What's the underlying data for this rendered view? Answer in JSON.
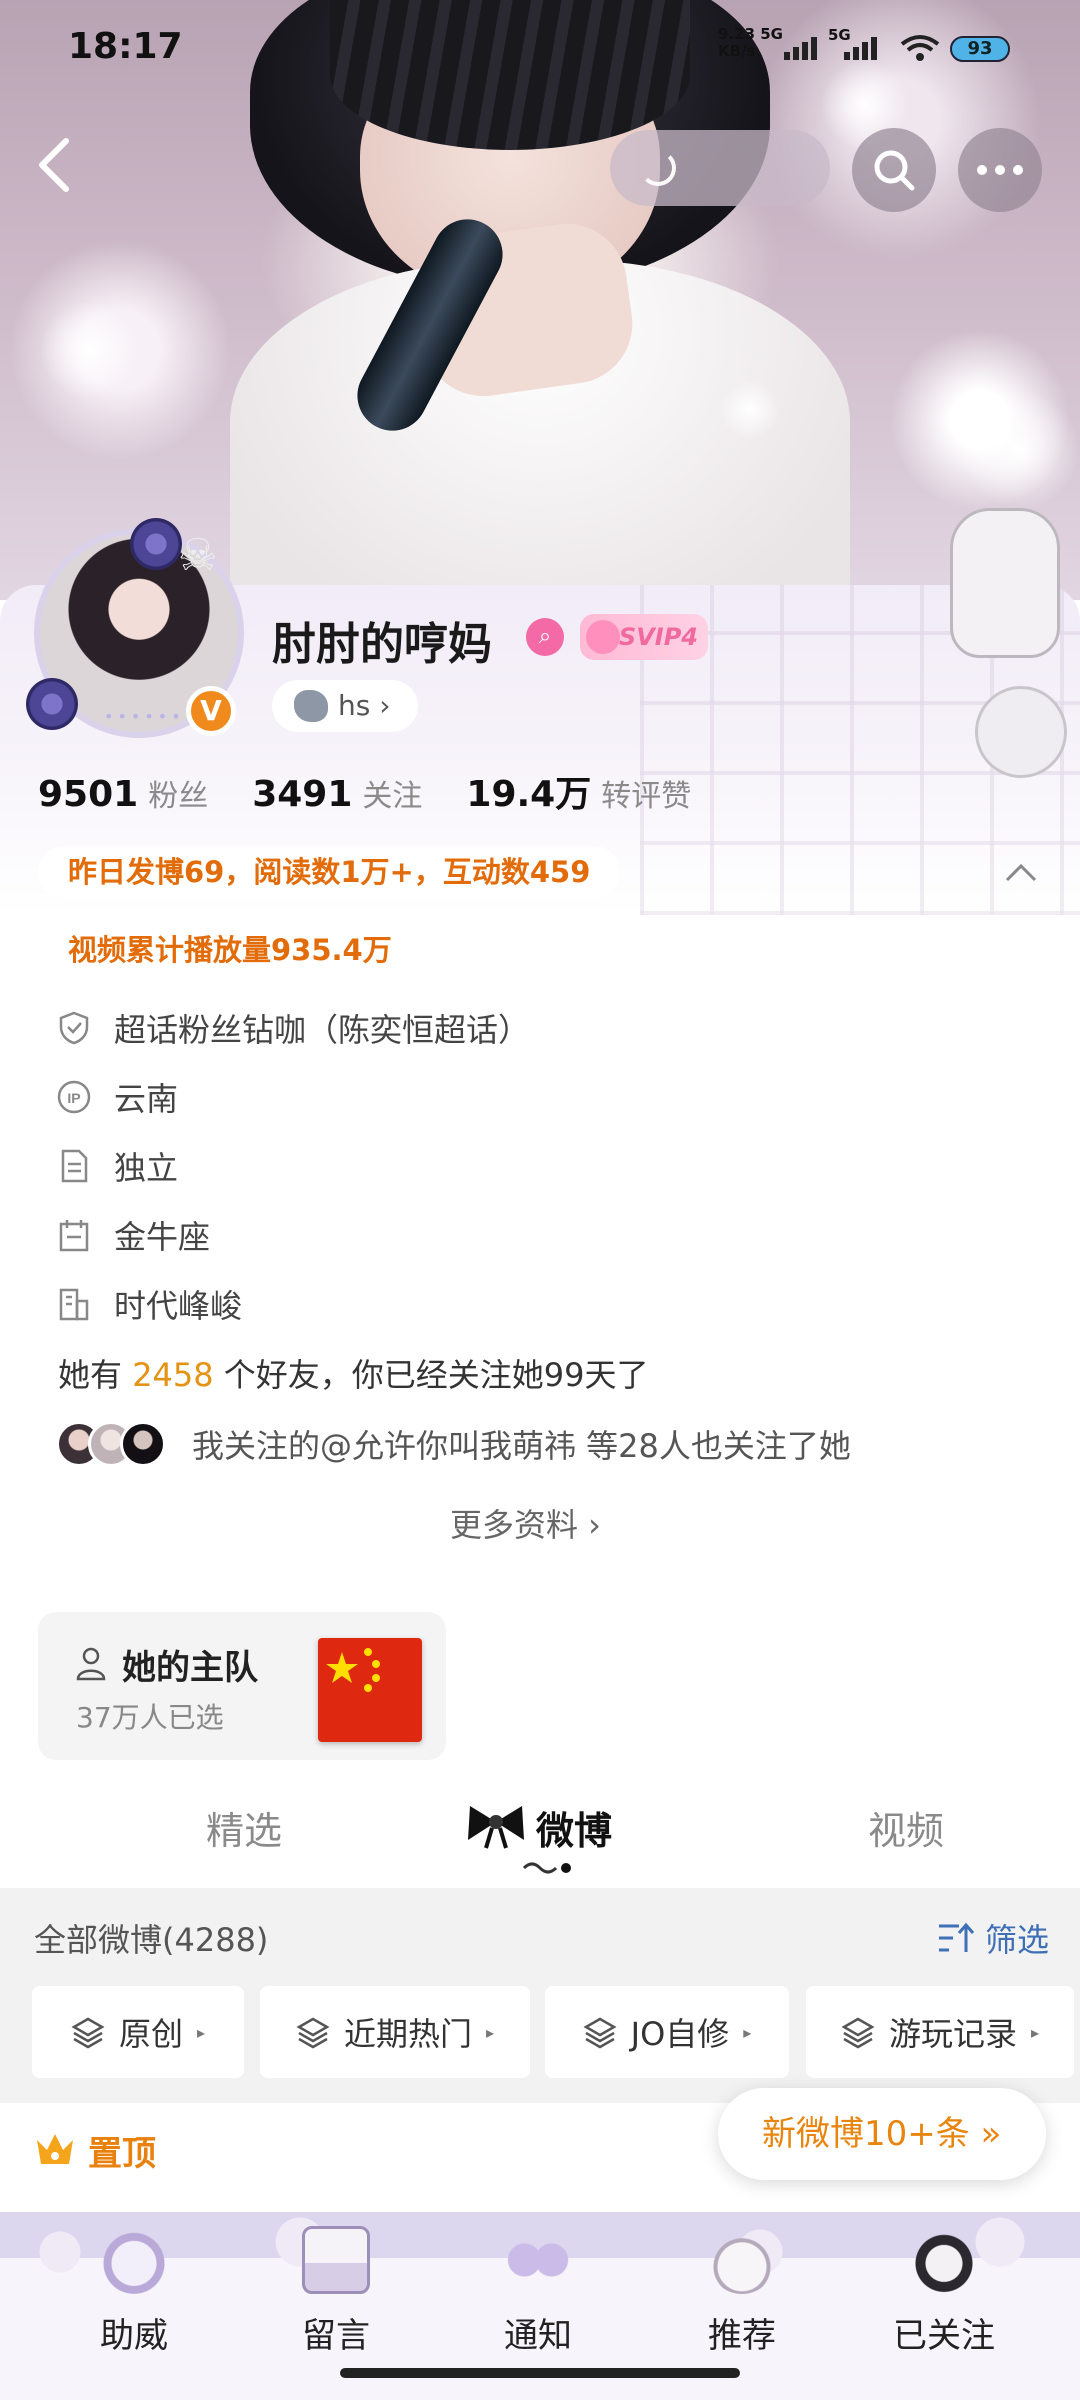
{
  "status_bar": {
    "time": "18:17",
    "net_speed_top": "9.23 5G",
    "net_speed_bottom": "KB/s",
    "signal2": "5G",
    "battery": "93"
  },
  "profile": {
    "name": "肘肘的哼妈",
    "vip_badge": "SVIP4",
    "tag": "hs",
    "tag_arrow": "›",
    "verified": "V"
  },
  "stats": [
    {
      "num": "9501",
      "label": "粉丝"
    },
    {
      "num": "3491",
      "label": "关注"
    },
    {
      "num": "19.4万",
      "label": "转评赞"
    }
  ],
  "highlights": {
    "yesterday": "昨日发博69，阅读数1万+，互动数459",
    "video_plays": "视频累计播放量935.4万"
  },
  "info": [
    {
      "icon": "super-topic-shield-icon",
      "text": "超话粉丝钻咖（陈奕恒超话）"
    },
    {
      "icon": "ip-location-icon",
      "text": "云南"
    },
    {
      "icon": "document-icon",
      "text": "独立"
    },
    {
      "icon": "calendar-icon",
      "text": "金牛座"
    },
    {
      "icon": "building-icon",
      "text": "时代峰峻"
    }
  ],
  "friends": {
    "prefix": "她有",
    "count": "2458",
    "suffix": "个好友，你已经关注她99天了"
  },
  "mutual": "我关注的@允许你叫我萌祎 等28人也关注了她",
  "more_info": "更多资料 ›",
  "team": {
    "title": "她的主队",
    "subtitle": "37万人已选"
  },
  "tabs": {
    "featured": "精选",
    "weibo": "微博",
    "video": "视频"
  },
  "feed": {
    "title": "全部微博(4288)",
    "filter_label": "筛选",
    "chips": [
      "原创",
      "近期热门",
      "JO自修",
      "游玩记录"
    ],
    "chip_arrow": "▸",
    "pinned": "置顶",
    "new_posts": "新微博10+条 »"
  },
  "bottom_nav": [
    {
      "label": "助威",
      "icon": "cheer-bag-icon"
    },
    {
      "label": "留言",
      "icon": "message-letter-icon"
    },
    {
      "label": "通知",
      "icon": "notification-bow-icon"
    },
    {
      "label": "推荐",
      "icon": "recommend-bunny-icon"
    },
    {
      "label": "已关注",
      "icon": "followed-cat-icon"
    }
  ],
  "colors": {
    "accent_orange": "#e36c0a",
    "filter_blue": "#3f6fb5",
    "friend_count": "#e59314"
  }
}
